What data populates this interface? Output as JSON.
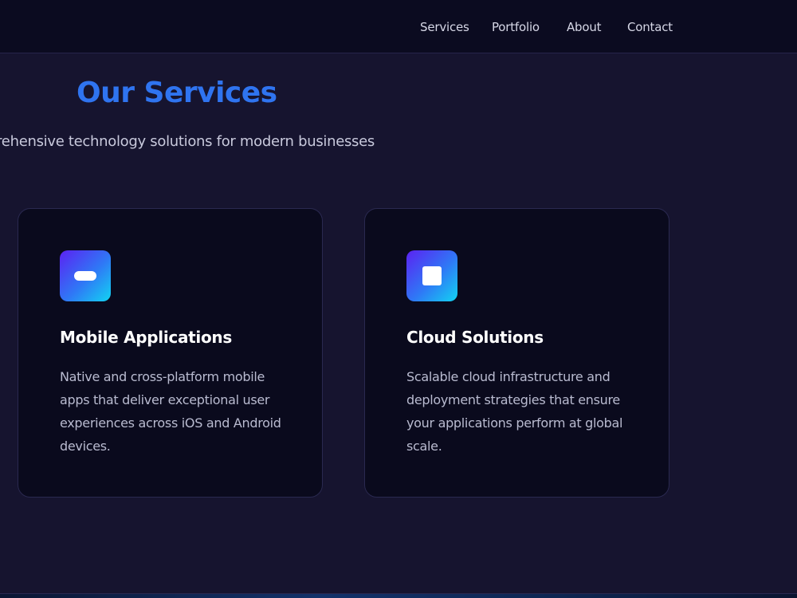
{
  "nav": {
    "items": [
      "Services",
      "Portfolio",
      "About",
      "Contact"
    ]
  },
  "section": {
    "title": "Our Services",
    "subtitle": "Comprehensive technology solutions for modern businesses"
  },
  "cards": [
    {
      "icon": "mobile-pill-icon",
      "title": "Mobile Applications",
      "description": "Native and cross-platform mobile apps that deliver exceptional user experiences across iOS and Android devices."
    },
    {
      "icon": "cloud-square-icon",
      "title": "Cloud Solutions",
      "description": "Scalable cloud infrastructure and deployment strategies that ensure your applications perform at global scale."
    }
  ],
  "colors": {
    "background": "#16142f",
    "header": "#0b0b20",
    "card": "#0a0a1d",
    "title_accent": "#2f74f0",
    "icon_gradient_start": "#5b22f2",
    "icon_gradient_end": "#12d4f2"
  }
}
